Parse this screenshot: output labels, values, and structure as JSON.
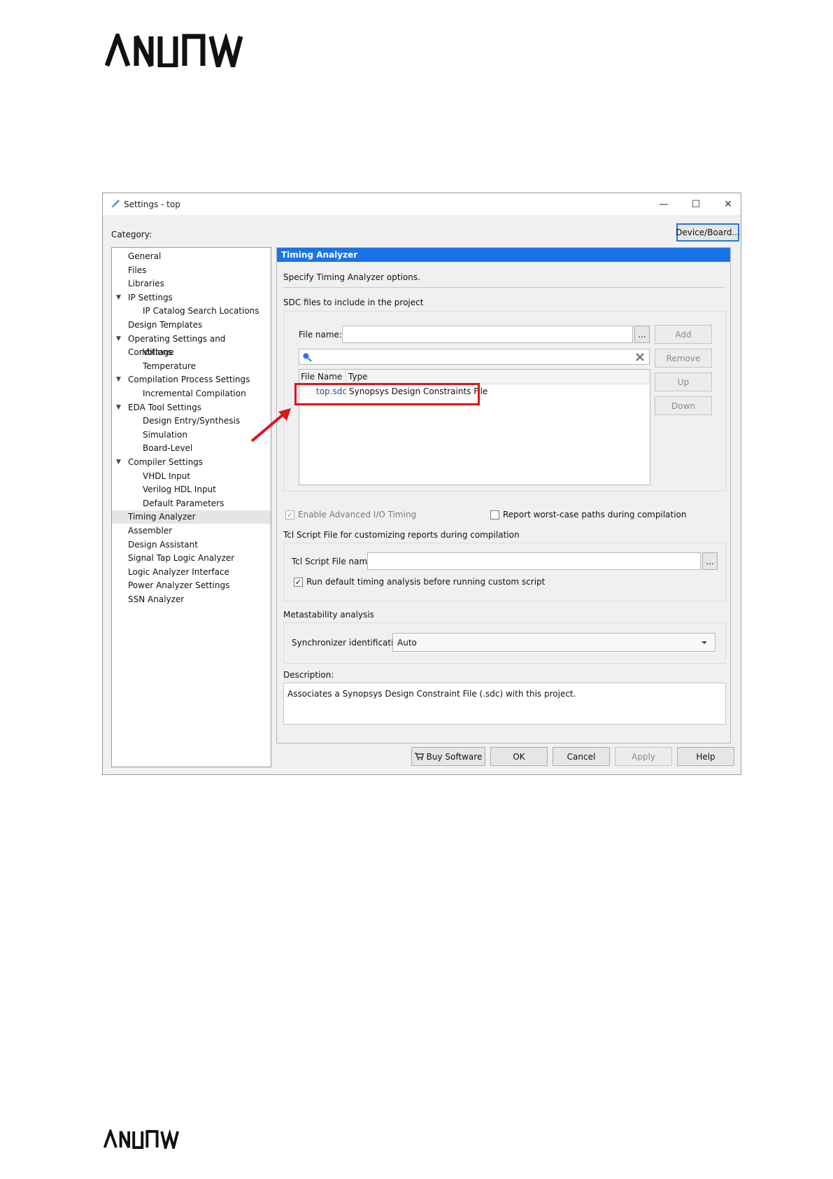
{
  "window": {
    "title": "Settings - top",
    "controls": {
      "minimize": "—",
      "maximize": "☐",
      "close": "✕"
    }
  },
  "category_label": "Category:",
  "device_board_button": "Device/Board...",
  "tree": [
    {
      "label": "General",
      "indent": 0,
      "caret": false
    },
    {
      "label": "Files",
      "indent": 0,
      "caret": false
    },
    {
      "label": "Libraries",
      "indent": 0,
      "caret": false
    },
    {
      "label": "IP Settings",
      "indent": 0,
      "caret": true
    },
    {
      "label": "IP Catalog Search Locations",
      "indent": 1,
      "caret": false
    },
    {
      "label": "Design Templates",
      "indent": 0,
      "caret": false
    },
    {
      "label": "Operating Settings and Conditions",
      "indent": 0,
      "caret": true
    },
    {
      "label": "Voltage",
      "indent": 1,
      "caret": false
    },
    {
      "label": "Temperature",
      "indent": 1,
      "caret": false
    },
    {
      "label": "Compilation Process Settings",
      "indent": 0,
      "caret": true
    },
    {
      "label": "Incremental Compilation",
      "indent": 1,
      "caret": false
    },
    {
      "label": "EDA Tool Settings",
      "indent": 0,
      "caret": true
    },
    {
      "label": "Design Entry/Synthesis",
      "indent": 1,
      "caret": false
    },
    {
      "label": "Simulation",
      "indent": 1,
      "caret": false
    },
    {
      "label": "Board-Level",
      "indent": 1,
      "caret": false
    },
    {
      "label": "Compiler Settings",
      "indent": 0,
      "caret": true
    },
    {
      "label": "VHDL Input",
      "indent": 1,
      "caret": false
    },
    {
      "label": "Verilog HDL Input",
      "indent": 1,
      "caret": false
    },
    {
      "label": "Default Parameters",
      "indent": 1,
      "caret": false
    },
    {
      "label": "Timing Analyzer",
      "indent": 0,
      "caret": false,
      "selected": true
    },
    {
      "label": "Assembler",
      "indent": 0,
      "caret": false
    },
    {
      "label": "Design Assistant",
      "indent": 0,
      "caret": false
    },
    {
      "label": "Signal Tap Logic Analyzer",
      "indent": 0,
      "caret": false
    },
    {
      "label": "Logic Analyzer Interface",
      "indent": 0,
      "caret": false
    },
    {
      "label": "Power Analyzer Settings",
      "indent": 0,
      "caret": false
    },
    {
      "label": "SSN Analyzer",
      "indent": 0,
      "caret": false
    }
  ],
  "panel": {
    "header": "Timing Analyzer",
    "intro": "Specify Timing Analyzer options.",
    "sdc_group_label": "SDC files to include in the project",
    "file_name_label": "File name:",
    "file_name_value": "",
    "browse": "...",
    "search_value": "",
    "buttons": {
      "add": "Add",
      "remove": "Remove",
      "up": "Up",
      "down": "Down"
    },
    "table": {
      "columns": [
        "File Name",
        "Type"
      ],
      "rows": [
        {
          "file": "top.sdc",
          "type": "Synopsys Design Constraints File"
        }
      ]
    },
    "enable_adv_io": "Enable Advanced I/O Timing",
    "report_worst_case": "Report worst-case paths during compilation",
    "tcl_group_label": "Tcl Script File for customizing reports during compilation",
    "tcl_file_label": "Tcl Script File name:",
    "tcl_file_value": "",
    "run_default": "Run default timing analysis before running custom script",
    "meta_group_label": "Metastability analysis",
    "sync_label": "Synchronizer identification:",
    "sync_value": "Auto",
    "description_label": "Description:",
    "description_text": "Associates a Synopsys Design Constraint File (.sdc) with this project."
  },
  "footer_buttons": {
    "buy": "Buy Software",
    "ok": "OK",
    "cancel": "Cancel",
    "apply": "Apply",
    "help": "Help"
  },
  "colors": {
    "accent": "#1a73e8",
    "highlight": "#e0141b"
  }
}
